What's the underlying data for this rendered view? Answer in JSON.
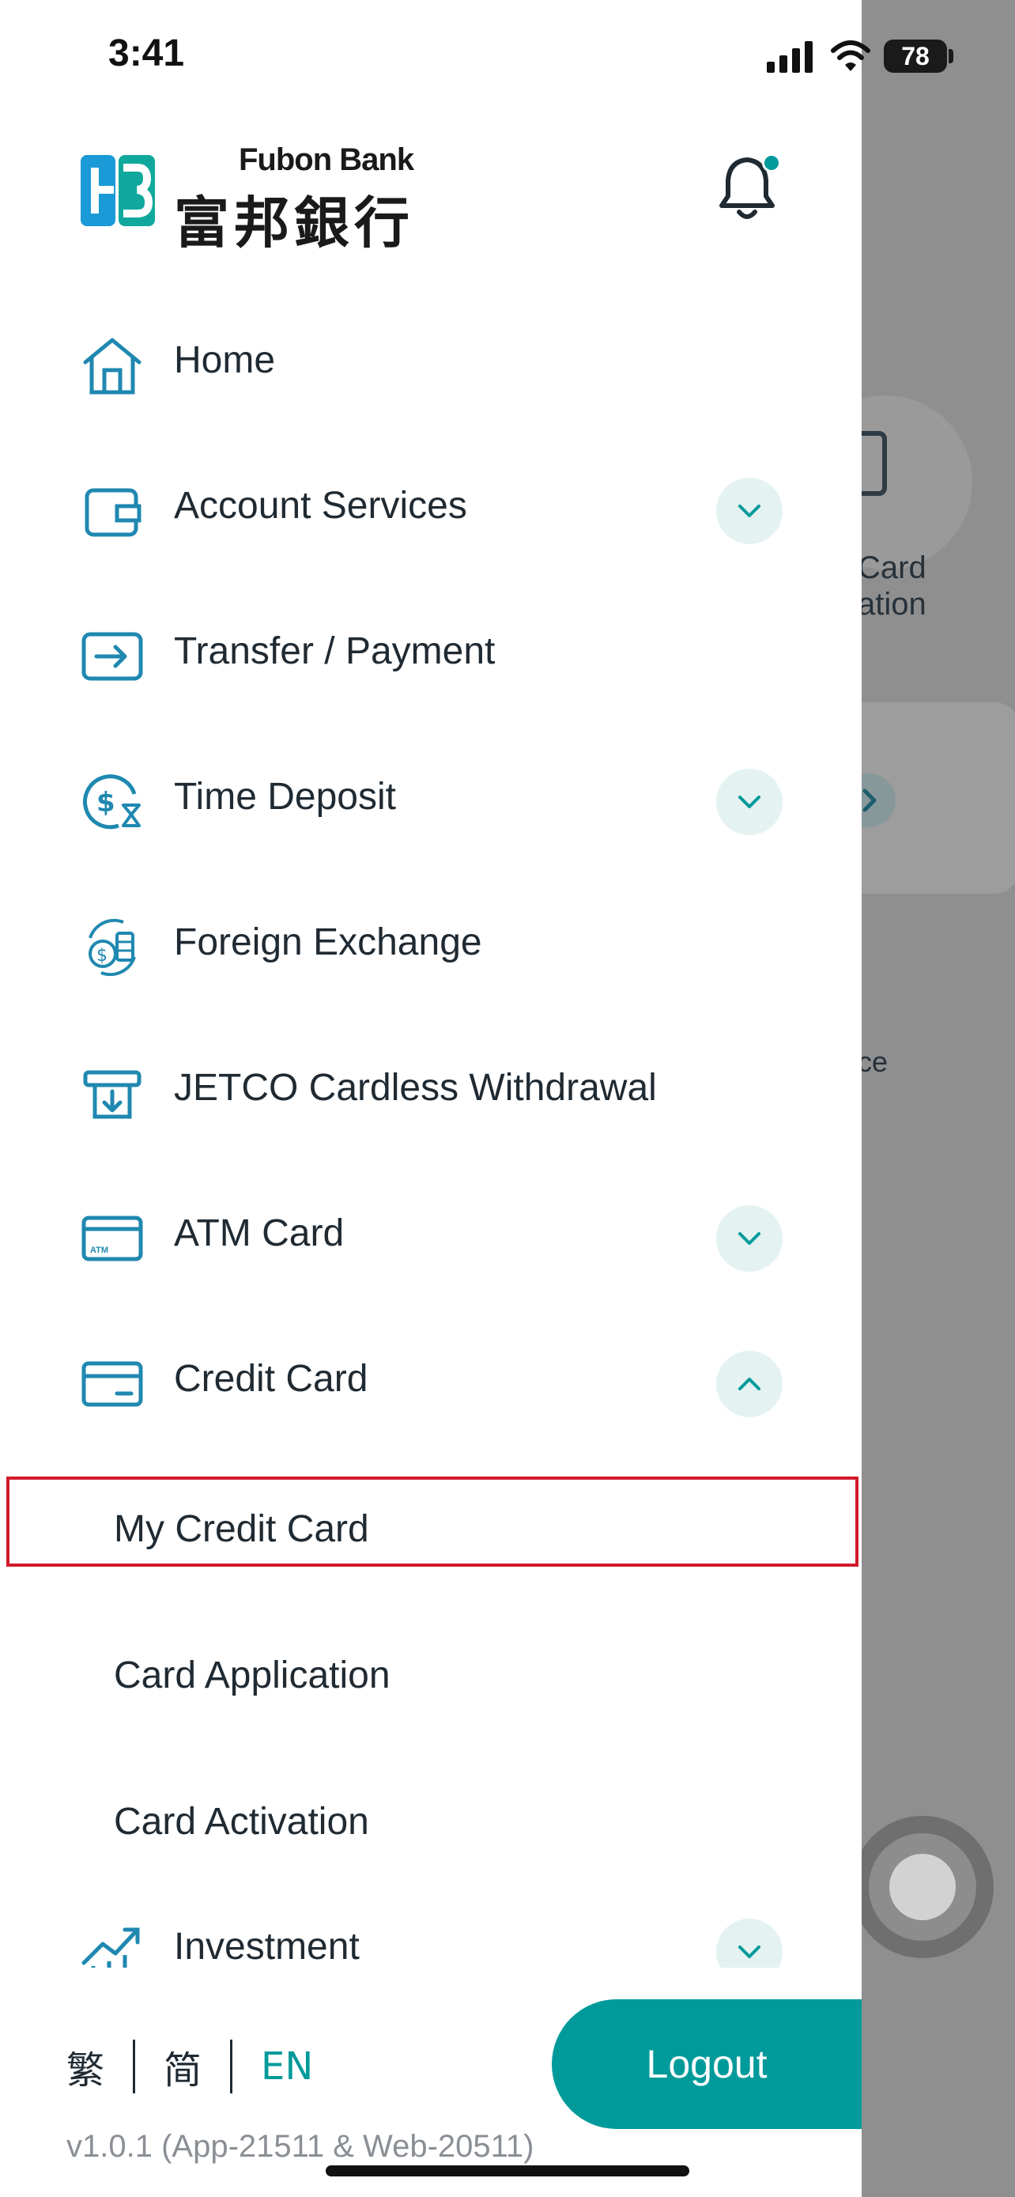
{
  "status_bar": {
    "time": "3:41",
    "battery": "78"
  },
  "brand": {
    "name_en": "Fubon Bank",
    "name_zh": "富邦銀行",
    "accent_color": "#009a9a"
  },
  "menu": {
    "items": [
      {
        "label": "Home",
        "icon": "home-icon",
        "has_chevron": false
      },
      {
        "label": "Account Services",
        "icon": "wallet-icon",
        "has_chevron": true,
        "expanded": false
      },
      {
        "label": "Transfer / Payment",
        "icon": "transfer-icon",
        "has_chevron": false
      },
      {
        "label": "Time Deposit",
        "icon": "time-deposit-icon",
        "has_chevron": true,
        "expanded": false
      },
      {
        "label": "Foreign Exchange",
        "icon": "foreign-exchange-icon",
        "has_chevron": false
      },
      {
        "label": "JETCO Cardless Withdrawal",
        "icon": "atm-withdrawal-icon",
        "has_chevron": false
      },
      {
        "label": "ATM Card",
        "icon": "atm-card-icon",
        "has_chevron": true,
        "expanded": false
      },
      {
        "label": "Credit Card",
        "icon": "credit-card-icon",
        "has_chevron": true,
        "expanded": true
      },
      {
        "label": "Investment",
        "icon": "investment-icon",
        "has_chevron": true,
        "expanded": false
      }
    ],
    "credit_card_sub": [
      {
        "label": "My Credit Card",
        "highlighted": true
      },
      {
        "label": "Card Application",
        "highlighted": false
      },
      {
        "label": "Card Activation",
        "highlighted": false
      }
    ],
    "atm_card_icon_text": "ATM"
  },
  "language": {
    "options": [
      "繁",
      "简",
      "EN"
    ],
    "selected": "EN"
  },
  "logout_label": "Logout",
  "version": "v1.0.1 (App-21511 & Web-20511)",
  "background_page": {
    "texts": [
      "Card",
      "ation",
      "ce"
    ]
  }
}
